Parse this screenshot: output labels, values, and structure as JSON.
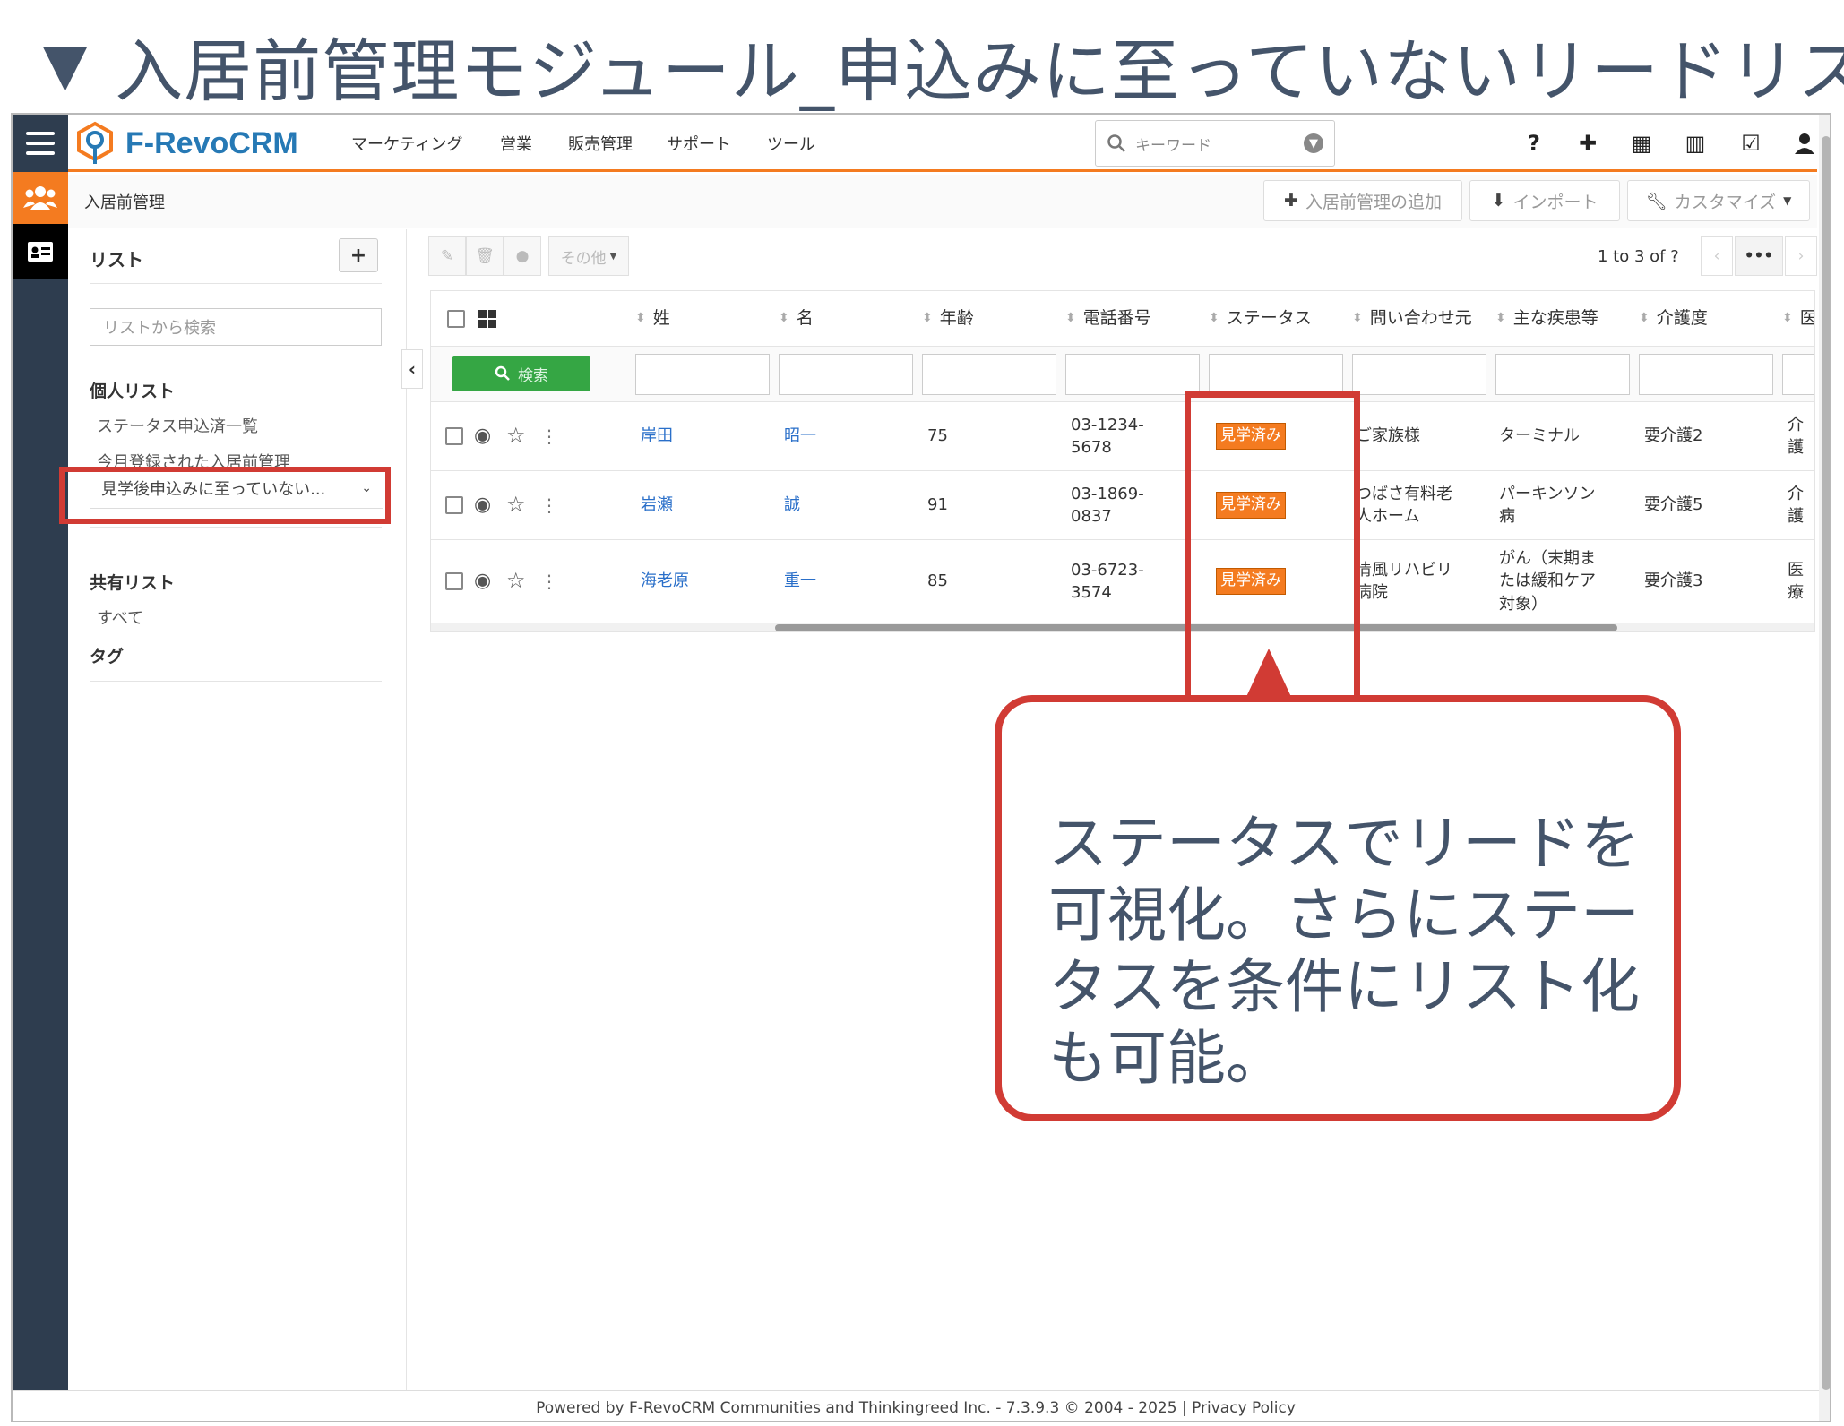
{
  "slide": {
    "title": "入居前管理モジュール_申込みに至っていないリードリスト",
    "marker": "▼"
  },
  "app": {
    "brand": "F-RevoCRM",
    "nav": [
      "マーケティング",
      "営業",
      "販売管理",
      "サポート",
      "ツール"
    ],
    "search_placeholder": "キーワード",
    "top_icons": {
      "help": "?",
      "add": "✚",
      "calendar": "▦",
      "reports": "▥",
      "tasks": "☑",
      "user": "●"
    }
  },
  "module": {
    "breadcrumb": "入居前管理",
    "add_button": "入居前管理の追加",
    "import_button": "インポート",
    "customize_button": "カスタマイズ"
  },
  "sidebar": {
    "list_title": "リスト",
    "add": "+",
    "search_placeholder": "リストから検索",
    "personal_title": "個人リスト",
    "personal_items": [
      "ステータス申込済一覧",
      "今月登録された入居前管理"
    ],
    "active_list": "見学後申込みに至っていない...",
    "shared_title": "共有リスト",
    "shared_items": [
      "すべて"
    ],
    "tags_title": "タグ"
  },
  "toolbar": {
    "more_label": "その他",
    "pager": "1 to 3  of ?",
    "dots": "•••"
  },
  "grid": {
    "columns": [
      "姓",
      "名",
      "年齢",
      "電話番号",
      "ステータス",
      "問い合わせ元",
      "主な疾患等",
      "介護度",
      "医"
    ],
    "search_button": "検索",
    "rows": [
      {
        "last": "岸田",
        "first": "昭一",
        "age": "75",
        "phone1": "03-1234-",
        "phone2": "5678",
        "status": "見学済み",
        "source1": "ご家族様",
        "source2": "",
        "disease1": "ターミナル",
        "disease2": "",
        "disease3": "",
        "care": "要介護2",
        "extra": "介護"
      },
      {
        "last": "岩瀬",
        "first": "誠",
        "age": "91",
        "phone1": "03-1869-",
        "phone2": "0837",
        "status": "見学済み",
        "source1": "つばさ有料老",
        "source2": "人ホーム",
        "disease1": "パーキンソン",
        "disease2": "病",
        "disease3": "",
        "care": "要介護5",
        "extra": "介護"
      },
      {
        "last": "海老原",
        "first": "重一",
        "age": "85",
        "phone1": "03-6723-",
        "phone2": "3574",
        "status": "見学済み",
        "source1": "清風リハビリ",
        "source2": "病院",
        "disease1": "がん（末期ま",
        "disease2": "たは緩和ケア",
        "disease3": "対象）",
        "care": "要介護3",
        "extra": "医療"
      }
    ]
  },
  "footer": {
    "text": "Powered by F-RevoCRM Communities and Thinkingreed Inc. - 7.3.9.3  © 2004 - 2025    |  Privacy Policy"
  },
  "callout": {
    "text": "ステータスでリードを可視化。さらにステータスを条件にリスト化も可能。"
  },
  "colors": {
    "accent": "#f47b20",
    "rail": "#2e3d4f",
    "highlight": "#d13b34",
    "link": "#2a6fc9",
    "search_green": "#35a644"
  }
}
